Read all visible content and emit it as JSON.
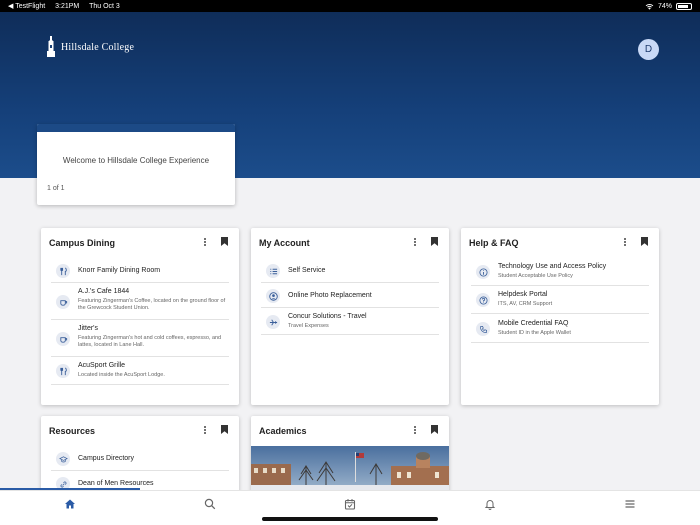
{
  "status_bar": {
    "back_app": "◀ TestFlight",
    "time": "3:21PM",
    "date": "Thu Oct 3",
    "battery": "74%"
  },
  "header": {
    "logo_text": "Hillsdale College",
    "avatar_initial": "D"
  },
  "welcome": {
    "text": "Welcome to Hillsdale College Experience",
    "pager": "1 of 1"
  },
  "cards": {
    "campus_dining": {
      "title": "Campus Dining",
      "items": [
        {
          "title": "Knorr Family Dining Room",
          "subtitle": "",
          "icon": "utensils-icon"
        },
        {
          "title": "A.J.'s Cafe 1844",
          "subtitle": "Featuring Zingerman's Coffee, located on the ground floor of the Grewcock Student Union.",
          "icon": "coffee-cup-icon"
        },
        {
          "title": "Jitter's",
          "subtitle": "Featuring Zingerman's hot and cold coffees, espresso, and lattes, located in Lane Hall.",
          "icon": "coffee-cup-icon"
        },
        {
          "title": "AcuSport Grille",
          "subtitle": "Located inside the AcuSport Lodge.",
          "icon": "utensils-icon"
        }
      ]
    },
    "my_account": {
      "title": "My Account",
      "items": [
        {
          "title": "Self Service",
          "subtitle": "",
          "icon": "list-icon"
        },
        {
          "title": "Online Photo Replacement",
          "subtitle": "",
          "icon": "user-circle-icon"
        },
        {
          "title": "Concur Solutions - Travel",
          "subtitle": "Travel Expenses",
          "icon": "plane-icon"
        }
      ]
    },
    "help_faq": {
      "title": "Help & FAQ",
      "items": [
        {
          "title": "Technology Use and Access Policy",
          "subtitle": "Student Acceptable Use Policy",
          "icon": "info-icon"
        },
        {
          "title": "Helpdesk Portal",
          "subtitle": "ITS, AV, CRM Support",
          "icon": "question-icon"
        },
        {
          "title": "Mobile Credential FAQ",
          "subtitle": "Student ID in the Apple Wallet",
          "icon": "phone-icon"
        }
      ]
    },
    "resources": {
      "title": "Resources",
      "items": [
        {
          "title": "Campus Directory",
          "subtitle": "",
          "icon": "graduation-cap-icon"
        },
        {
          "title": "Dean of Men Resources",
          "subtitle": "",
          "icon": "link-icon"
        }
      ]
    },
    "academics": {
      "title": "Academics"
    }
  },
  "tab_bar": {
    "tabs": [
      {
        "name": "home-icon",
        "active": true
      },
      {
        "name": "search-icon",
        "active": false
      },
      {
        "name": "calendar-icon",
        "active": false
      },
      {
        "name": "bell-icon",
        "active": false
      },
      {
        "name": "menu-icon",
        "active": false
      }
    ]
  },
  "colors": {
    "primary": "#1c4a86",
    "hero_dark": "#0f2d59",
    "active_tab": "#2a5ba6"
  }
}
